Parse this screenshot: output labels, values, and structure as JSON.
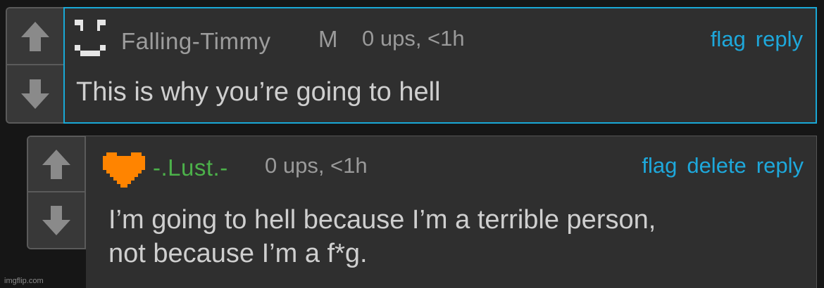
{
  "comments": [
    {
      "username": "Falling-Timmy",
      "badge": "M",
      "ups": "0 ups, <1h",
      "actions": [
        "flag",
        "reply"
      ],
      "text": "This is why you’re going to hell",
      "avatar_icon": "pixel-smiley-icon",
      "name_color": "#9d9d9d"
    },
    {
      "username": "-.Lust.-",
      "ups": "0 ups, <1h",
      "actions": [
        "flag",
        "delete",
        "reply"
      ],
      "text_lines": [
        "I’m going to hell because I’m a terrible person,",
        "not because I’m a f*g."
      ],
      "avatar_icon": "pixel-heart-icon",
      "name_color": "#4cb14a",
      "stripe_color": "#ff8400"
    }
  ],
  "colors": {
    "link": "#1ea8db",
    "highlight_border": "#19a8d6",
    "background": "#161616",
    "panel": "#2f2f2f"
  },
  "watermark": "imgflip.com"
}
